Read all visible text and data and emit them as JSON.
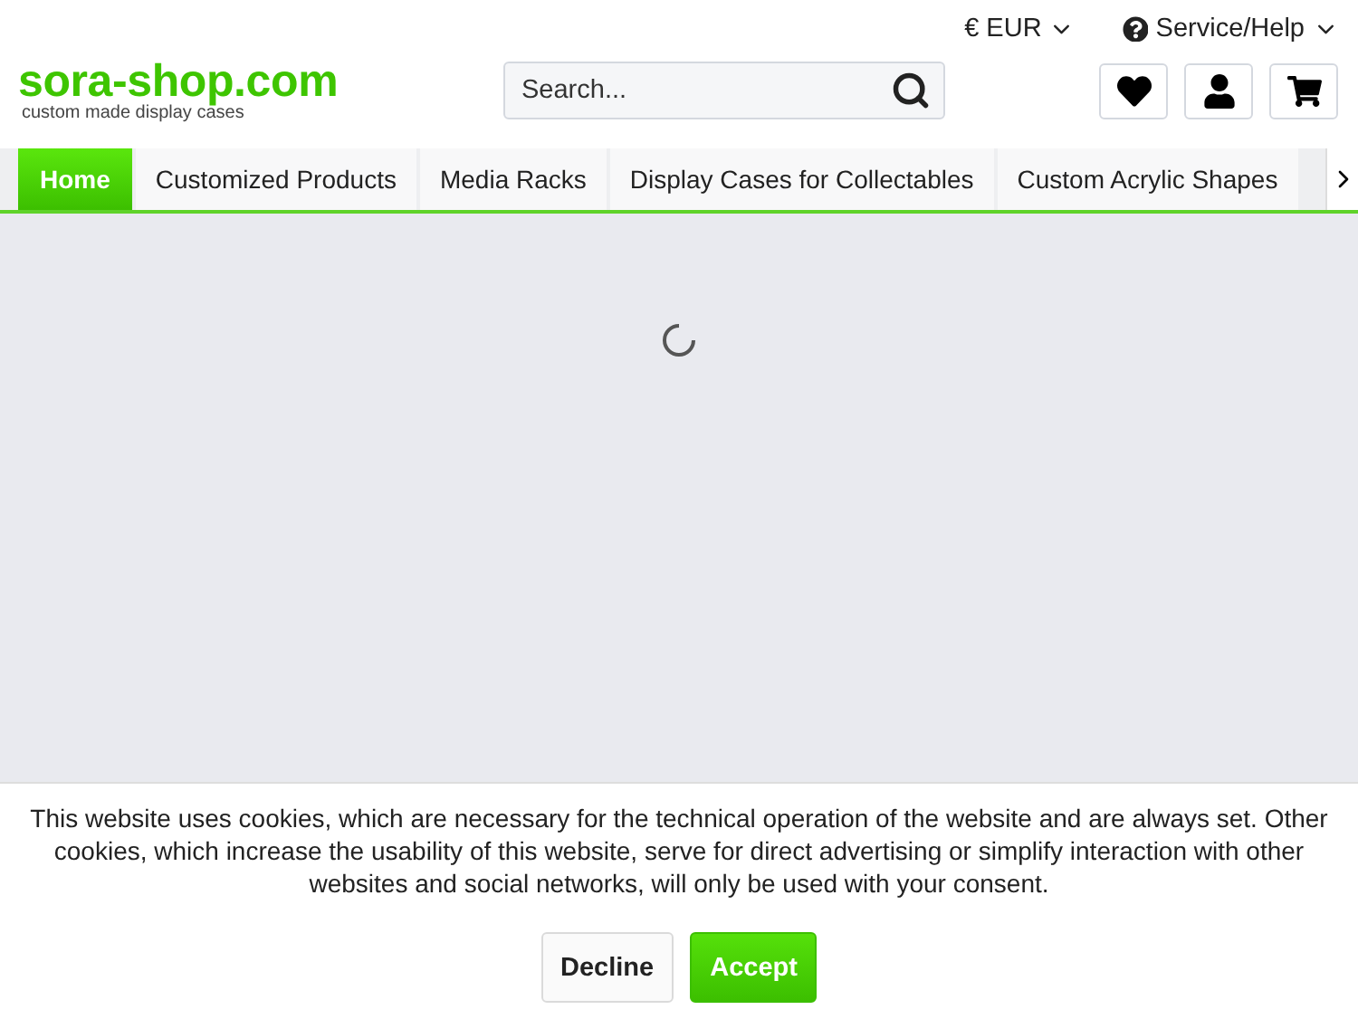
{
  "top_bar": {
    "currency": "€ EUR",
    "service": "Service/Help"
  },
  "logo": {
    "name": "sora-shop.com",
    "tagline": "custom made display cases"
  },
  "search": {
    "placeholder": "Search..."
  },
  "nav": {
    "tabs": [
      {
        "label": "Home",
        "selected": true
      },
      {
        "label": "Customized Products",
        "selected": false
      },
      {
        "label": "Media Racks",
        "selected": false
      },
      {
        "label": "Display Cases for Collectables",
        "selected": false
      },
      {
        "label": "Custom Acrylic Shapes",
        "selected": false
      }
    ]
  },
  "content": {
    "loading": true
  },
  "cookie_banner": {
    "text": "This website uses cookies, which are necessary for the technical operation of the website and are always set. Other cookies, which increase the usability of this website, serve for direct advertising or simplify interaction with other websites and social networks, will only be used with your consent.",
    "buttons": [
      {
        "label": "Decline",
        "kind": "secondary"
      },
      {
        "label": "Accept",
        "kind": "primary"
      }
    ]
  }
}
